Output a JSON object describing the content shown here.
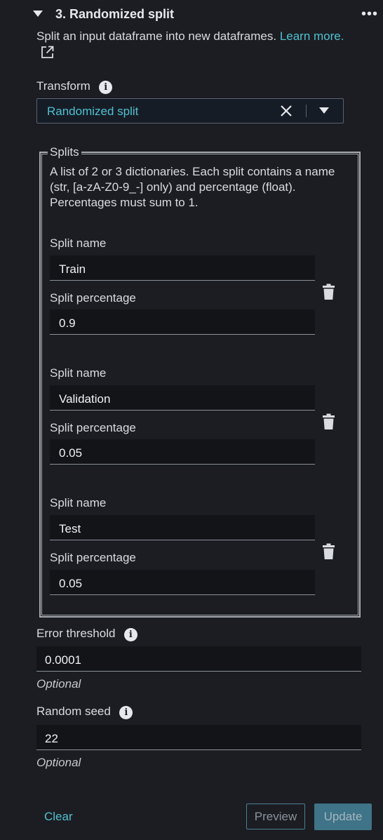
{
  "header": {
    "title": "3. Randomized split",
    "more_label": "•••"
  },
  "description": {
    "text": "Split an input dataframe into new dataframes. ",
    "link": "Learn more."
  },
  "transform": {
    "label": "Transform",
    "info": "i",
    "value": "Randomized split"
  },
  "splits": {
    "legend": "Splits",
    "help": "A list of 2 or 3 dictionaries. Each split contains a name (str, [a-zA-Z0-9_-] only) and percentage (float). Percentages must sum to 1.",
    "items": [
      {
        "name_label": "Split name",
        "name": "Train",
        "pct_label": "Split percentage",
        "pct": "0.9"
      },
      {
        "name_label": "Split name",
        "name": "Validation",
        "pct_label": "Split percentage",
        "pct": "0.05"
      },
      {
        "name_label": "Split name",
        "name": "Test",
        "pct_label": "Split percentage",
        "pct": "0.05"
      }
    ]
  },
  "error_threshold": {
    "label": "Error threshold",
    "info": "i",
    "value": "0.0001",
    "hint": "Optional"
  },
  "random_seed": {
    "label": "Random seed",
    "info": "i",
    "value": "22",
    "hint": "Optional"
  },
  "footer": {
    "clear": "Clear",
    "preview": "Preview",
    "update": "Update"
  },
  "colors": {
    "accent": "#4fc0d0",
    "background": "#1b1d22",
    "button": "#3f7387"
  }
}
